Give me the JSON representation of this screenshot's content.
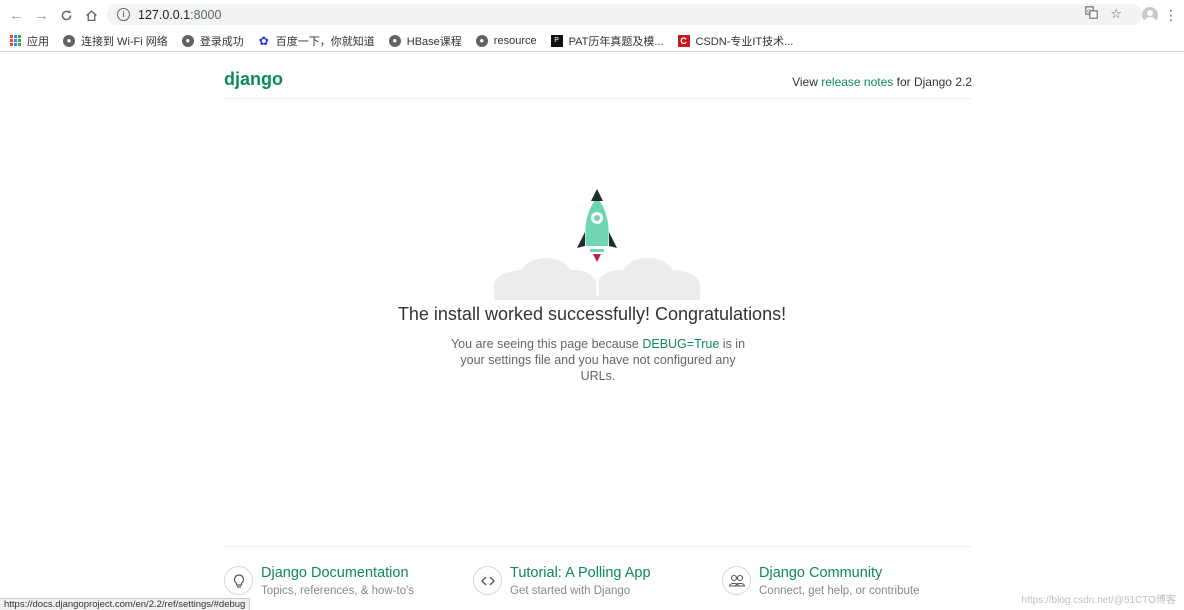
{
  "browser": {
    "url_host": "127.0.0.1",
    "url_port": ":8000",
    "status_url": "https://docs.djangoproject.com/en/2.2/ref/settings/#debug",
    "icons": {
      "back": "arrow-left-icon",
      "forward": "arrow-right-icon",
      "reload": "reload-icon",
      "home": "home-icon",
      "info": "info-icon",
      "translate": "translate-icon",
      "star": "star-icon",
      "profile": "profile-icon",
      "menu": "vertical-dots-icon"
    }
  },
  "bookmarks": [
    {
      "label": "应用",
      "icon": "apps-grid-icon"
    },
    {
      "label": "连接到 Wi-Fi 网络",
      "icon": "globe-icon"
    },
    {
      "label": "登录成功",
      "icon": "globe-icon"
    },
    {
      "label": "百度一下，你就知道",
      "icon": "baidu-paw-icon"
    },
    {
      "label": "HBase课程",
      "icon": "globe-icon"
    },
    {
      "label": "resource",
      "icon": "globe-icon"
    },
    {
      "label": "PAT历年真题及模...",
      "icon": "pat-icon"
    },
    {
      "label": "CSDN-专业IT技术...",
      "icon": "csdn-icon"
    }
  ],
  "header": {
    "logo": "django",
    "release_prefix": "View ",
    "release_link": "release notes",
    "release_suffix": " for Django 2.2"
  },
  "main": {
    "title": "The install worked successfully! Congratulations!",
    "desc_prefix": "You are seeing this page because ",
    "desc_debug": "DEBUG=True",
    "desc_suffix": " is in your settings file and you have not configured any URLs."
  },
  "footer": {
    "cards": [
      {
        "title": "Django Documentation",
        "subtitle": "Topics, references, & how-to's",
        "icon": "lightbulb-icon"
      },
      {
        "title": "Tutorial: A Polling App",
        "subtitle": "Get started with Django",
        "icon": "code-brackets-icon"
      },
      {
        "title": "Django Community",
        "subtitle": "Connect, get help, or contribute",
        "icon": "people-icon"
      }
    ]
  },
  "watermark": "https://blog.csdn.net/@51CTO博客",
  "colors": {
    "django_green": "#0c8a5a",
    "rocket_body": "#6ed4b4",
    "cloud": "#ececec",
    "toolbar_bg": "#f1f3f4"
  }
}
